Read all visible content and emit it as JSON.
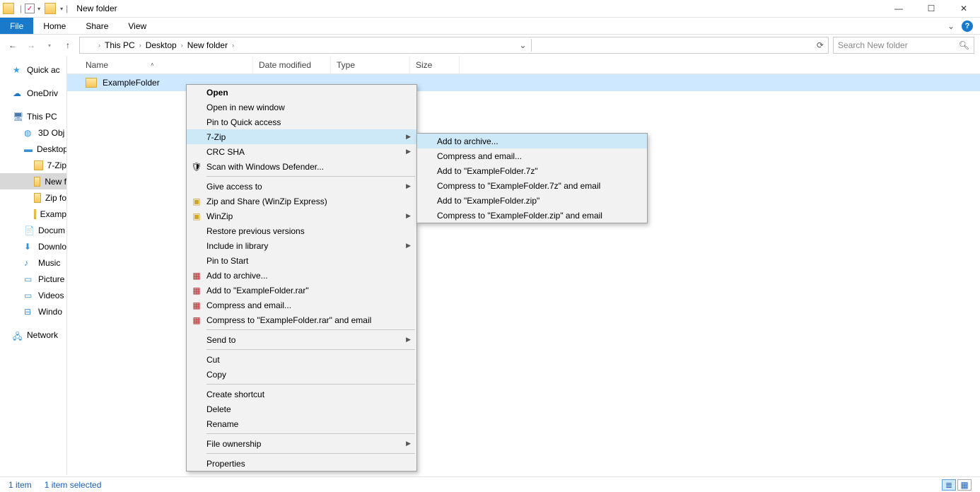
{
  "titlebar": {
    "title": "New folder"
  },
  "ribbon": {
    "file": "File",
    "tabs": [
      "Home",
      "Share",
      "View"
    ]
  },
  "nav": {
    "crumbs": [
      "This PC",
      "Desktop",
      "New folder"
    ]
  },
  "search": {
    "placeholder": "Search New folder"
  },
  "sidebar": {
    "quick": "Quick ac",
    "onedrive": "OneDriv",
    "thispc": "This PC",
    "items": [
      "3D Obj",
      "Desktop",
      "7-Zip",
      "New f",
      "Zip fo",
      "Examp",
      "Docum",
      "Downlo",
      "Music",
      "Picture",
      "Videos",
      "Windo"
    ],
    "network": "Network"
  },
  "columns": {
    "name": "Name",
    "date": "Date modified",
    "type": "Type",
    "size": "Size"
  },
  "row": {
    "name": "ExampleFolder"
  },
  "ctx1": {
    "open": "Open",
    "opennew": "Open in new window",
    "pin": "Pin to Quick access",
    "sevenzip": "7-Zip",
    "crc": "CRC SHA",
    "defender": "Scan with Windows Defender...",
    "access": "Give access to",
    "winzip_express": "Zip and Share (WinZip Express)",
    "winzip": "WinZip",
    "restore": "Restore previous versions",
    "library": "Include in library",
    "pinstart": "Pin to Start",
    "addarchive": "Add to archive...",
    "addrar": "Add to \"ExampleFolder.rar\"",
    "compressemail": "Compress and email...",
    "compressraremail": "Compress to \"ExampleFolder.rar\" and email",
    "sendto": "Send to",
    "cut": "Cut",
    "copy": "Copy",
    "shortcut": "Create shortcut",
    "delete": "Delete",
    "rename": "Rename",
    "ownership": "File ownership",
    "properties": "Properties"
  },
  "ctx2": {
    "add": "Add to archive...",
    "compressemail": "Compress and email...",
    "add7z": "Add to \"ExampleFolder.7z\"",
    "compress7zemail": "Compress to \"ExampleFolder.7z\" and email",
    "addzip": "Add to \"ExampleFolder.zip\"",
    "compresszipemail": "Compress to \"ExampleFolder.zip\" and email"
  },
  "status": {
    "count": "1 item",
    "selected": "1 item selected"
  }
}
